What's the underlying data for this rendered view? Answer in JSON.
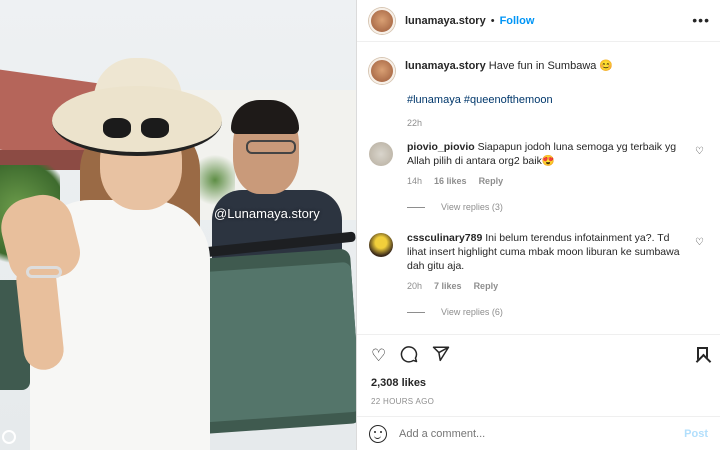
{
  "post": {
    "watermark": "@Lunamaya.story"
  },
  "header": {
    "username": "lunamaya.story",
    "separator": "•",
    "follow_label": "Follow",
    "more_icon": "more-horizontal-icon"
  },
  "caption": {
    "username": "lunamaya.story",
    "text": "Have fun in Sumbawa 😊",
    "tags": "#lunamaya #queenofthemoon",
    "time": "22h"
  },
  "comments": [
    {
      "username": "piovio_piovio",
      "text": "Siapapun jodoh luna semoga yg terbaik yg Allah pilih di antara org2 baik😍",
      "time": "14h",
      "likes": "16 likes",
      "reply": "Reply",
      "view_replies": "View replies (3)"
    },
    {
      "username": "cssculinary789",
      "text": "Ini belum terendus infotainment ya?. Td lihat insert highlight cuma mbak moon liburan ke sumbawa dah gitu aja.",
      "time": "20h",
      "likes": "7 likes",
      "reply": "Reply",
      "view_replies": "View replies (6)"
    }
  ],
  "actions": {
    "like_icon": "heart-icon",
    "comment_icon": "comment-icon",
    "share_icon": "send-icon",
    "save_icon": "bookmark-icon",
    "likes": "2,308 likes",
    "post_time": "22 HOURS AGO"
  },
  "add_comment": {
    "placeholder": "Add a comment...",
    "post_label": "Post"
  },
  "colors": {
    "accent": "#0095f6",
    "link": "#00376b",
    "muted": "#8e8e8e",
    "post_disabled": "#b2dffc"
  }
}
